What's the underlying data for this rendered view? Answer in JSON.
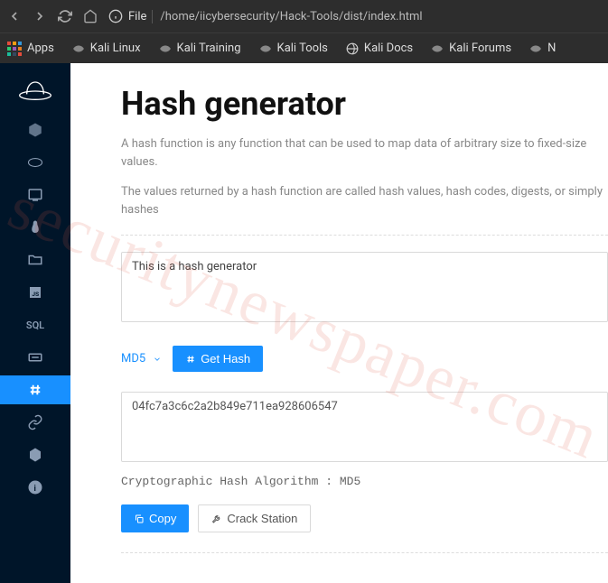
{
  "browser": {
    "url_scheme": "File",
    "url_path": "/home/iicybersecurity/Hack-Tools/dist/index.html"
  },
  "bookmarks": {
    "apps": "Apps",
    "items": [
      "Kali Linux",
      "Kali Training",
      "Kali Tools",
      "Kali Docs",
      "Kali Forums",
      "N"
    ]
  },
  "sidebar": {
    "sql_label": "SQL"
  },
  "page": {
    "title": "Hash generator",
    "desc1": "A hash function is any function that can be used to map data of arbitrary size to fixed-size values.",
    "desc2": "The values returned by a hash function are called hash values, hash codes, digests, or simply hashes",
    "input_value": "This is a hash generator",
    "select_label": "MD5",
    "get_hash_label": "Get Hash",
    "output_value": "04fc7a3c6c2a2b849e711ea928606547",
    "algo_line": "Cryptographic Hash Algorithm : MD5",
    "copy_label": "Copy",
    "crack_label": "Crack Station"
  },
  "watermark": "securitynewspaper.com"
}
